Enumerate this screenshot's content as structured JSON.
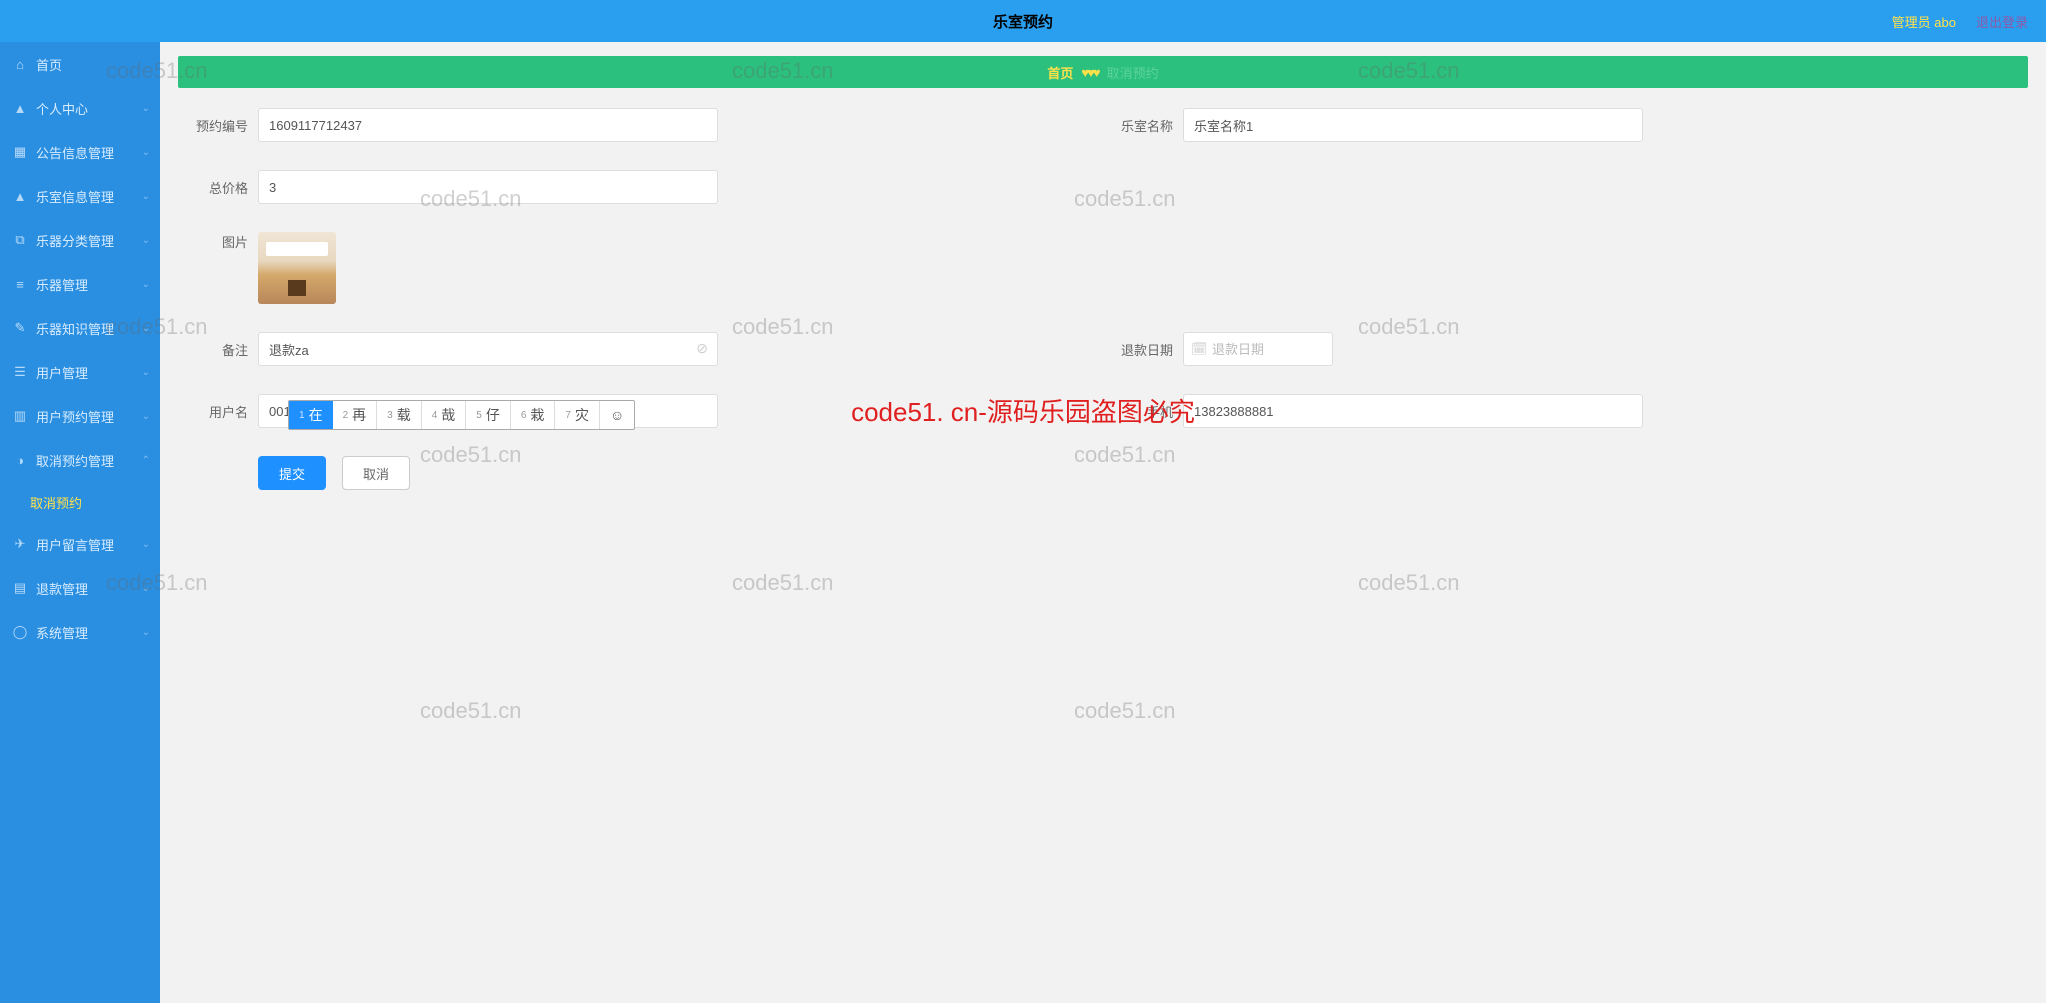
{
  "header": {
    "title": "乐室预约",
    "admin_label": "管理员 abo",
    "logout_label": "退出登录"
  },
  "sidebar": {
    "items": [
      {
        "icon": "home",
        "label": "首页",
        "expandable": false
      },
      {
        "icon": "user",
        "label": "个人中心",
        "expandable": true
      },
      {
        "icon": "grid",
        "label": "公告信息管理",
        "expandable": true
      },
      {
        "icon": "room",
        "label": "乐室信息管理",
        "expandable": true
      },
      {
        "icon": "copy",
        "label": "乐器分类管理",
        "expandable": true
      },
      {
        "icon": "list",
        "label": "乐器管理",
        "expandable": true
      },
      {
        "icon": "book",
        "label": "乐器知识管理",
        "expandable": true
      },
      {
        "icon": "users",
        "label": "用户管理",
        "expandable": true
      },
      {
        "icon": "cal",
        "label": "用户预约管理",
        "expandable": true
      },
      {
        "icon": "cancel",
        "label": "取消预约管理",
        "expandable": true,
        "expanded": true
      },
      {
        "icon": "msg",
        "label": "用户留言管理",
        "expandable": true
      },
      {
        "icon": "refund",
        "label": "退款管理",
        "expandable": true
      },
      {
        "icon": "gear",
        "label": "系统管理",
        "expandable": true
      }
    ],
    "sub_label": "取消预约"
  },
  "breadcrumb": {
    "home": "首页",
    "hearts": "♥♥♥",
    "current": "取消预约"
  },
  "form": {
    "booking_no": {
      "label": "预约编号",
      "value": "1609117712437"
    },
    "room_name": {
      "label": "乐室名称",
      "value": "乐室名称1"
    },
    "total": {
      "label": "总价格",
      "value": "3"
    },
    "image": {
      "label": "图片"
    },
    "remark": {
      "label": "备注",
      "value": "退款za"
    },
    "refund_date": {
      "label": "退款日期",
      "placeholder": "退款日期",
      "value": ""
    },
    "username": {
      "label": "用户名",
      "value": "001"
    },
    "phone": {
      "label": "手机",
      "value": "13823888881"
    },
    "submit": "提交",
    "cancel": "取消"
  },
  "ime": {
    "candidates": [
      {
        "n": "1",
        "t": "在"
      },
      {
        "n": "2",
        "t": "再"
      },
      {
        "n": "3",
        "t": "载"
      },
      {
        "n": "4",
        "t": "哉"
      },
      {
        "n": "5",
        "t": "仔"
      },
      {
        "n": "6",
        "t": "栽"
      },
      {
        "n": "7",
        "t": "灾"
      }
    ]
  },
  "watermark_text": "code51.cn",
  "watermark_red": "code51. cn-源码乐园盗图必究"
}
